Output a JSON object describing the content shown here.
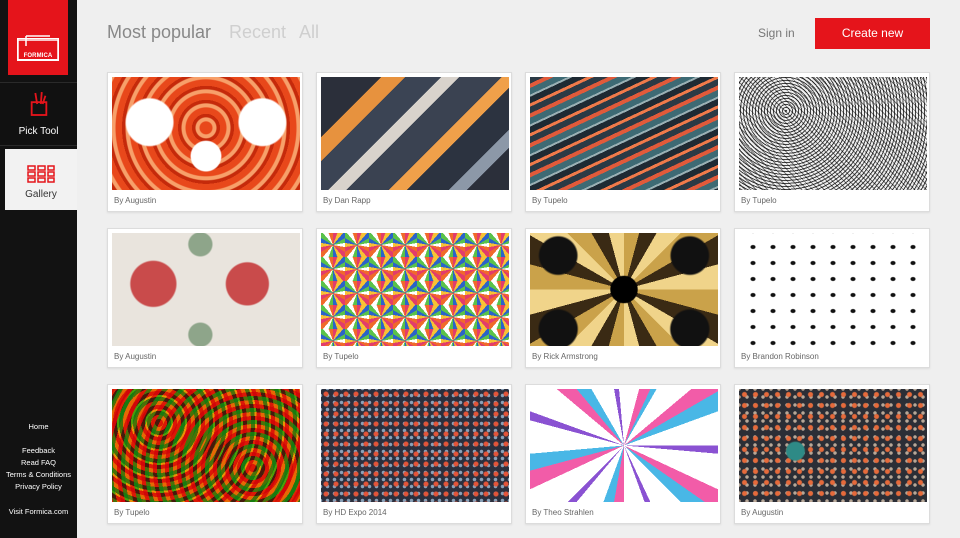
{
  "brand": {
    "logo_text": "FORMICA",
    "accent_color": "#e5141b"
  },
  "sidebar": {
    "nav": [
      {
        "label": "Pick Tool",
        "icon": "brush-cup-icon",
        "active": false
      },
      {
        "label": "Gallery",
        "icon": "grid-icon",
        "active": true
      }
    ],
    "footer_links": [
      "Home",
      "Feedback",
      "Read FAQ",
      "Terms & Conditions",
      "Privacy Policy"
    ],
    "visit_link": "Visit Formica.com"
  },
  "header": {
    "tabs": [
      {
        "label": "Most popular",
        "active": true
      },
      {
        "label": "Recent",
        "active": false
      },
      {
        "label": "All",
        "active": false
      }
    ],
    "sign_in": "Sign in",
    "create_new": "Create new"
  },
  "gallery": {
    "items": [
      {
        "author": "By Augustin"
      },
      {
        "author": "By Dan Rapp"
      },
      {
        "author": "By Tupelo"
      },
      {
        "author": "By Tupelo"
      },
      {
        "author": "By Augustin"
      },
      {
        "author": "By Tupelo"
      },
      {
        "author": "By Rick Armstrong"
      },
      {
        "author": "By Brandon Robinson"
      },
      {
        "author": "By Tupelo"
      },
      {
        "author": "By HD Expo 2014"
      },
      {
        "author": "By Theo Strahlen"
      },
      {
        "author": "By Augustin"
      }
    ]
  }
}
